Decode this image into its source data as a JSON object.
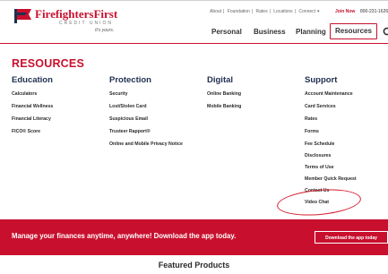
{
  "logo": {
    "name": "FirefightersFirst",
    "sub": "CREDIT UNION",
    "tagline": "It's yours."
  },
  "utility": {
    "links": [
      "About",
      "Foundation",
      "Rates",
      "Locations",
      "Connect"
    ],
    "separator": "|",
    "connect_caret": "▾",
    "join": "Join Now",
    "phone": "800-231-1626"
  },
  "nav": {
    "personal": "Personal",
    "business": "Business",
    "planning": "Planning",
    "resources": "Resources"
  },
  "menu": {
    "title": "RESOURCES",
    "columns": [
      {
        "heading": "Education",
        "items": [
          "Calculators",
          "Financial Wellness",
          "Financial Literacy",
          "FICO® Score"
        ]
      },
      {
        "heading": "Protection",
        "items": [
          "Security",
          "Lost/Stolen Card",
          "Suspicious Email",
          "Trusteer Rapport®",
          "Online and Mobile Privacy Notice"
        ]
      },
      {
        "heading": "Digital",
        "items": [
          "Online Banking",
          "Mobile Banking"
        ]
      },
      {
        "heading": "Support",
        "items": [
          "Account Maintenance",
          "Card Services",
          "Rates",
          "Forms",
          "Fee Schedule",
          "Disclosures",
          "Terms of Use",
          "Member Quick Request",
          "Contact Us",
          "Video Chat"
        ]
      }
    ]
  },
  "banner": {
    "text": "Manage your finances anytime, anywhere!  Download the app today.",
    "button": "Download the app today"
  },
  "featured": {
    "title": "Featured Products"
  },
  "colors": {
    "brand_red": "#c8102e",
    "heading_navy": "#1f2f4f",
    "annotation_red": "#d81e2c"
  },
  "icons": {
    "search": "search-icon",
    "logo_flag": "flag-logo-icon"
  }
}
